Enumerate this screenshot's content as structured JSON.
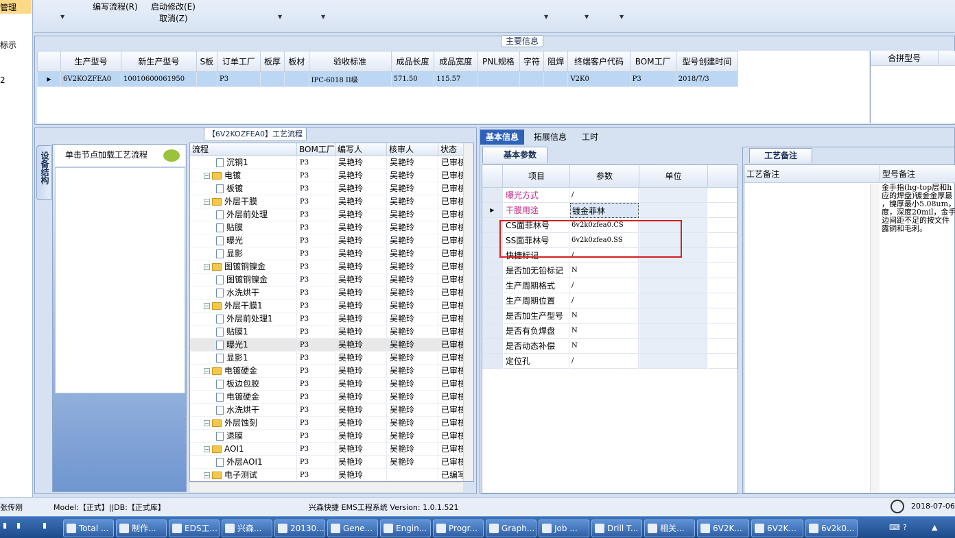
{
  "left_strip": {
    "item0": "管理",
    "item1": "标示",
    "item2": "2",
    "user": "张传刚"
  },
  "ribbon": {
    "edit_flow": "编写流程(R)",
    "start_modify": "启动修改(E)",
    "cancel": "取消(Z)"
  },
  "main_info": {
    "title": "主要信息",
    "columns": [
      "生产型号",
      "新生产型号",
      "S板",
      "订单工厂",
      "板厚",
      "板材",
      "验收标准",
      "成品长度",
      "成品宽度",
      "PNL规格",
      "字符",
      "阻焊",
      "终端客户代码",
      "BOM工厂",
      "型号创建时间"
    ],
    "row": [
      "6V2KOZFEA0",
      "10010600061950",
      "",
      "P3",
      "",
      "",
      "IPC-6018 II级",
      "571.50",
      "115.57",
      "",
      "",
      "",
      "V2K0",
      "P3",
      "2018/7/3"
    ],
    "side_col": "合拼型号"
  },
  "flow_panel": {
    "title": "【6V2KOZFEA0】工艺流程",
    "vertical_tab": "设备结构",
    "equip_hint": "单击节点加载工艺流程",
    "columns": [
      "流程",
      "BOM工厂",
      "编写人",
      "核审人",
      "状态"
    ],
    "rows": [
      {
        "name": "沉铜1",
        "type": "doc",
        "indent": 2,
        "bom": "P3",
        "author": "吴艳玲",
        "reviewer": "吴艳玲",
        "status": "已审核"
      },
      {
        "name": "电镀",
        "type": "folder",
        "indent": 1,
        "bom": "P3",
        "author": "吴艳玲",
        "reviewer": "吴艳玲",
        "status": "已审核"
      },
      {
        "name": "板镀",
        "type": "doc",
        "indent": 2,
        "bom": "P3",
        "author": "吴艳玲",
        "reviewer": "吴艳玲",
        "status": "已审核"
      },
      {
        "name": "外层干膜",
        "type": "folder",
        "indent": 1,
        "bom": "P3",
        "author": "吴艳玲",
        "reviewer": "吴艳玲",
        "status": "已审核"
      },
      {
        "name": "外层前处理",
        "type": "doc",
        "indent": 2,
        "bom": "P3",
        "author": "吴艳玲",
        "reviewer": "吴艳玲",
        "status": "已审核"
      },
      {
        "name": "贴膜",
        "type": "doc",
        "indent": 2,
        "bom": "P3",
        "author": "吴艳玲",
        "reviewer": "吴艳玲",
        "status": "已审核"
      },
      {
        "name": "曝光",
        "type": "doc",
        "indent": 2,
        "bom": "P3",
        "author": "吴艳玲",
        "reviewer": "吴艳玲",
        "status": "已审核"
      },
      {
        "name": "显影",
        "type": "doc",
        "indent": 2,
        "bom": "P3",
        "author": "吴艳玲",
        "reviewer": "吴艳玲",
        "status": "已审核"
      },
      {
        "name": "图镀铜镍金",
        "type": "folder",
        "indent": 1,
        "bom": "P3",
        "author": "吴艳玲",
        "reviewer": "吴艳玲",
        "status": "已审核"
      },
      {
        "name": "图镀铜镍金",
        "type": "doc",
        "indent": 2,
        "bom": "P3",
        "author": "吴艳玲",
        "reviewer": "吴艳玲",
        "status": "已审核"
      },
      {
        "name": "水洗烘干",
        "type": "doc",
        "indent": 2,
        "bom": "P3",
        "author": "吴艳玲",
        "reviewer": "吴艳玲",
        "status": "已审核"
      },
      {
        "name": "外层干膜1",
        "type": "folder",
        "indent": 1,
        "bom": "P3",
        "author": "吴艳玲",
        "reviewer": "吴艳玲",
        "status": "已审核"
      },
      {
        "name": "外层前处理1",
        "type": "doc",
        "indent": 2,
        "bom": "P3",
        "author": "吴艳玲",
        "reviewer": "吴艳玲",
        "status": "已审核"
      },
      {
        "name": "贴膜1",
        "type": "doc",
        "indent": 2,
        "bom": "P3",
        "author": "吴艳玲",
        "reviewer": "吴艳玲",
        "status": "已审核"
      },
      {
        "name": "曝光1",
        "type": "doc",
        "indent": 2,
        "bom": "P3",
        "author": "吴艳玲",
        "reviewer": "吴艳玲",
        "status": "已审核",
        "selected": true
      },
      {
        "name": "显影1",
        "type": "doc",
        "indent": 2,
        "bom": "P3",
        "author": "吴艳玲",
        "reviewer": "吴艳玲",
        "status": "已审核"
      },
      {
        "name": "电镀硬金",
        "type": "folder",
        "indent": 1,
        "bom": "P3",
        "author": "吴艳玲",
        "reviewer": "吴艳玲",
        "status": "已审核"
      },
      {
        "name": "板边包胶",
        "type": "doc",
        "indent": 2,
        "bom": "P3",
        "author": "吴艳玲",
        "reviewer": "吴艳玲",
        "status": "已审核"
      },
      {
        "name": "电镀硬金",
        "type": "doc",
        "indent": 2,
        "bom": "P3",
        "author": "吴艳玲",
        "reviewer": "吴艳玲",
        "status": "已审核"
      },
      {
        "name": "水洗烘干",
        "type": "doc",
        "indent": 2,
        "bom": "P3",
        "author": "吴艳玲",
        "reviewer": "吴艳玲",
        "status": "已审核"
      },
      {
        "name": "外层蚀刻",
        "type": "folder",
        "indent": 1,
        "bom": "P3",
        "author": "吴艳玲",
        "reviewer": "吴艳玲",
        "status": "已审核"
      },
      {
        "name": "退膜",
        "type": "doc",
        "indent": 2,
        "bom": "P3",
        "author": "吴艳玲",
        "reviewer": "吴艳玲",
        "status": "已审核"
      },
      {
        "name": "AOI1",
        "type": "folder",
        "indent": 1,
        "bom": "P3",
        "author": "吴艳玲",
        "reviewer": "吴艳玲",
        "status": "已审核"
      },
      {
        "name": "外层AOI1",
        "type": "doc",
        "indent": 2,
        "bom": "P3",
        "author": "吴艳玲",
        "reviewer": "吴艳玲",
        "status": "已审核"
      },
      {
        "name": "电子测试",
        "type": "folder",
        "indent": 1,
        "bom": "P3",
        "author": "吴艳玲",
        "reviewer": "",
        "status": "已编写"
      }
    ]
  },
  "detail_tabs": {
    "basic": "基本信息",
    "extended": "拓展信息",
    "hours": "工时"
  },
  "basic_params": {
    "sub_tab": "基本参数",
    "columns": [
      "项目",
      "参数",
      "单位"
    ],
    "rows": [
      {
        "key": "曝光方式",
        "value": "/",
        "pink": true
      },
      {
        "key": "干膜用途",
        "value": "镀金菲林",
        "pink": true,
        "current": true
      },
      {
        "key": "CS面菲林号",
        "value": "6v2k0zfea0.CS"
      },
      {
        "key": "SS面菲林号",
        "value": "6v2k0zfea0.SS"
      },
      {
        "key": "快捷标记",
        "value": "/"
      },
      {
        "key": "是否加无铅标记",
        "value": "N"
      },
      {
        "key": "生产周期格式",
        "value": "/"
      },
      {
        "key": "生产周期位置",
        "value": "/"
      },
      {
        "key": "是否加生产型号",
        "value": "N"
      },
      {
        "key": "是否有负焊盘",
        "value": "N"
      },
      {
        "key": "是否动态补偿",
        "value": "N"
      },
      {
        "key": "定位孔",
        "value": "/"
      }
    ]
  },
  "notes": {
    "tab": "工艺备注",
    "col1": "工艺备注",
    "col2": "型号备注",
    "model_note": "金手指(hg-top层和h\n应的焊盘)镀金金厚最\n，镍厚最小5.08um，\n度，深度20mil，金手\n边间距不足的按文件\n露铜和毛刺。"
  },
  "status": {
    "model": "Model:【正式】||DB:【正式库】",
    "system": "兴森快捷 EMS工程系统 Version: 1.0.1.521",
    "date": "2018-07-06"
  },
  "taskbar": [
    "Total ...",
    "制作...",
    "EDS工...",
    "兴森...",
    "20130...",
    "Gene...",
    "Engin...",
    "Progr...",
    "Graph...",
    "Job ...",
    "Drill T...",
    "相关...",
    "6V2K...",
    "6V2K...",
    "6v2k0..."
  ]
}
